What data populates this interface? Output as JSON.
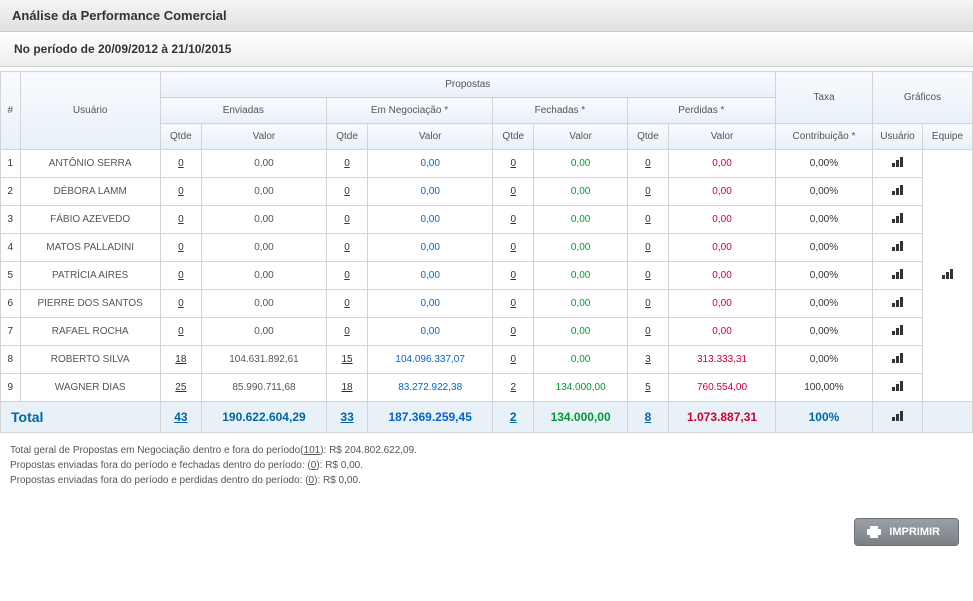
{
  "header": {
    "title": "Análise da Performance Comercial",
    "subtitle": "No período de 20/09/2012 à 21/10/2015"
  },
  "table": {
    "headers": {
      "idx": "#",
      "usuario": "Usuário",
      "propostas": "Propostas",
      "taxa": "Taxa",
      "graficos": "Gráficos",
      "enviadas": "Enviadas",
      "em_negociacao": "Em Negociação *",
      "fechadas": "Fechadas *",
      "perdidas": "Perdidas *",
      "qtde": "Qtde",
      "valor": "Valor",
      "contribuicao": "Contribuição *",
      "usuario_graf": "Usuário",
      "equipe": "Equipe"
    },
    "rows": [
      {
        "idx": "1",
        "user": "ANTÔNIO SERRA",
        "env_q": "0",
        "env_v": "0,00",
        "neg_q": "0",
        "neg_v": "0,00",
        "fec_q": "0",
        "fec_v": "0,00",
        "per_q": "0",
        "per_v": "0,00",
        "taxa": "0,00%"
      },
      {
        "idx": "2",
        "user": "DÉBORA LAMM",
        "env_q": "0",
        "env_v": "0,00",
        "neg_q": "0",
        "neg_v": "0,00",
        "fec_q": "0",
        "fec_v": "0,00",
        "per_q": "0",
        "per_v": "0,00",
        "taxa": "0,00%"
      },
      {
        "idx": "3",
        "user": "FÁBIO AZEVEDO",
        "env_q": "0",
        "env_v": "0,00",
        "neg_q": "0",
        "neg_v": "0,00",
        "fec_q": "0",
        "fec_v": "0,00",
        "per_q": "0",
        "per_v": "0,00",
        "taxa": "0,00%"
      },
      {
        "idx": "4",
        "user": "MATOS PALLADINI",
        "env_q": "0",
        "env_v": "0,00",
        "neg_q": "0",
        "neg_v": "0,00",
        "fec_q": "0",
        "fec_v": "0,00",
        "per_q": "0",
        "per_v": "0,00",
        "taxa": "0,00%"
      },
      {
        "idx": "5",
        "user": "PATRÍCIA AIRES",
        "env_q": "0",
        "env_v": "0,00",
        "neg_q": "0",
        "neg_v": "0,00",
        "fec_q": "0",
        "fec_v": "0,00",
        "per_q": "0",
        "per_v": "0,00",
        "taxa": "0,00%"
      },
      {
        "idx": "6",
        "user": "PIERRE DOS SANTOS",
        "env_q": "0",
        "env_v": "0,00",
        "neg_q": "0",
        "neg_v": "0,00",
        "fec_q": "0",
        "fec_v": "0,00",
        "per_q": "0",
        "per_v": "0,00",
        "taxa": "0,00%"
      },
      {
        "idx": "7",
        "user": "RAFAEL ROCHA",
        "env_q": "0",
        "env_v": "0,00",
        "neg_q": "0",
        "neg_v": "0,00",
        "fec_q": "0",
        "fec_v": "0,00",
        "per_q": "0",
        "per_v": "0,00",
        "taxa": "0,00%"
      },
      {
        "idx": "8",
        "user": "ROBERTO SILVA",
        "env_q": "18",
        "env_v": "104.631.892,61",
        "neg_q": "15",
        "neg_v": "104.096.337,07",
        "fec_q": "0",
        "fec_v": "0,00",
        "per_q": "3",
        "per_v": "313.333,31",
        "taxa": "0,00%"
      },
      {
        "idx": "9",
        "user": "WAGNER DIAS",
        "env_q": "25",
        "env_v": "85.990.711,68",
        "neg_q": "18",
        "neg_v": "83.272.922,38",
        "fec_q": "2",
        "fec_v": "134.000,00",
        "per_q": "5",
        "per_v": "760.554,00",
        "taxa": "100,00%"
      }
    ],
    "total": {
      "label": "Total",
      "env_q": "43",
      "env_v": "190.622.604,29",
      "neg_q": "33",
      "neg_v": "187.369.259,45",
      "fec_q": "2",
      "fec_v": "134.000,00",
      "per_q": "8",
      "per_v": "1.073.887,31",
      "taxa": "100%"
    }
  },
  "notes": {
    "line1_a": "Total geral de Propostas em Negociação dentro e fora do período(",
    "line1_u": "101",
    "line1_b": "): R$ 204.802.622,09.",
    "line2_a": "Propostas enviadas fora do período e fechadas dentro do período: (",
    "line2_u": "0",
    "line2_b": "): R$ 0,00.",
    "line3_a": "Propostas enviadas fora do período e perdidas dentro do período: (",
    "line3_u": "0",
    "line3_b": "): R$ 0,00."
  },
  "buttons": {
    "imprimir": "IMPRIMIR"
  }
}
